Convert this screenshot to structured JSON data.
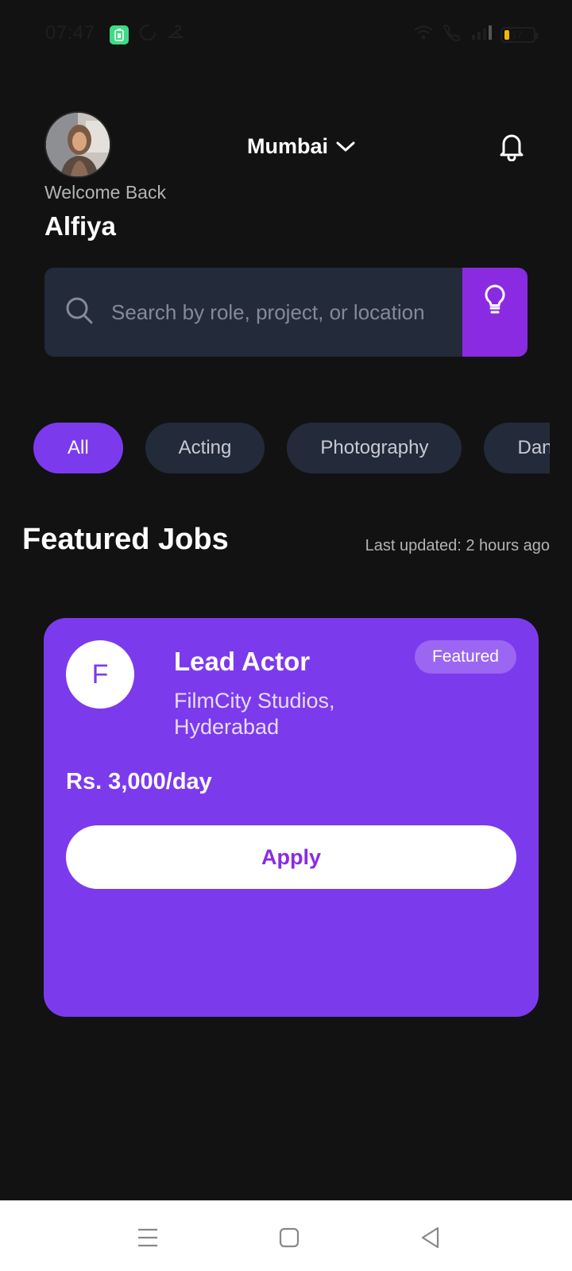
{
  "status_bar": {
    "time": "07:47",
    "battery": "17",
    "icons": [
      "battery-saver-icon",
      "sync-icon",
      "hanger-icon",
      "wifi-icon",
      "call-signal-icon",
      "cell-signal-icon",
      "battery-icon"
    ]
  },
  "header": {
    "location": "Mumbai",
    "welcome_text": "Welcome Back",
    "user_name": "Alfiya"
  },
  "search": {
    "placeholder": "Search by role, project, or location",
    "value": ""
  },
  "categories": [
    "All",
    "Acting",
    "Photography",
    "Dance"
  ],
  "featured": {
    "title": "Featured Jobs",
    "last_updated": "Last updated: 2 hours ago"
  },
  "job": {
    "logo_letter": "F",
    "title": "Lead Actor",
    "company": "FilmCity Studios, Hyderabad",
    "badge": "Featured",
    "salary": "Rs. 3,000/day",
    "apply_label": "Apply"
  },
  "colors": {
    "background": "#121212",
    "accent": "#7c3aed",
    "surface": "#232a3a",
    "apply_text": "#8a2be2"
  }
}
